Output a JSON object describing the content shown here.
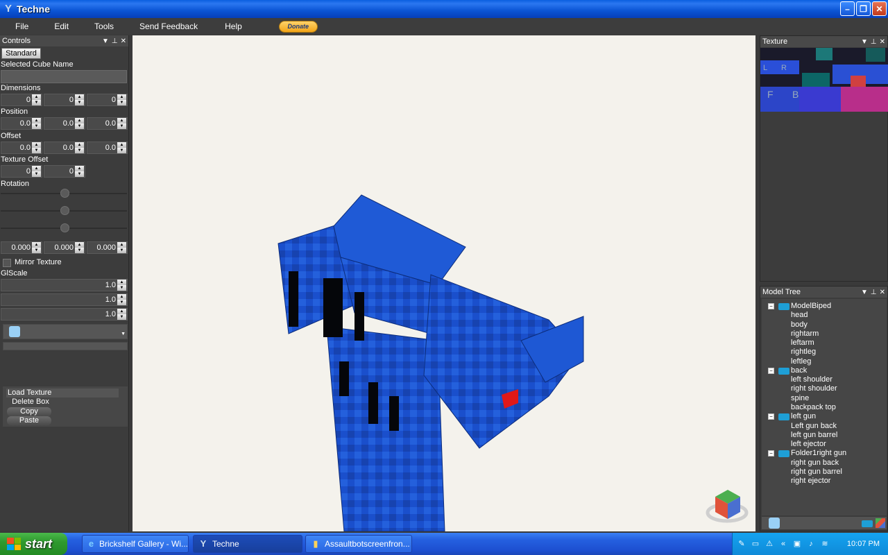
{
  "window": {
    "title": "Techne"
  },
  "menu": {
    "items": [
      "File",
      "Edit",
      "Tools",
      "Send Feedback",
      "Help"
    ],
    "donate": "Donate"
  },
  "controls": {
    "title": "Controls",
    "standard_tab": "Standard",
    "selected_cube_name_label": "Selected Cube Name",
    "selected_cube_name_value": "",
    "dimensions_label": "Dimensions",
    "dimensions": [
      "0",
      "0",
      "0"
    ],
    "position_label": "Position",
    "position": [
      "0.0",
      "0.0",
      "0.0"
    ],
    "offset_label": "Offset",
    "offset": [
      "0.0",
      "0.0",
      "0.0"
    ],
    "texture_offset_label": "Texture Offset",
    "texture_offset": [
      "0",
      "0"
    ],
    "rotation_label": "Rotation",
    "rotation": [
      "0.000",
      "0.000",
      "0.000"
    ],
    "mirror_texture_label": "Mirror Texture",
    "glscale_label": "GlScale",
    "glscale": [
      "1.0",
      "1.0",
      "1.0"
    ],
    "actions": [
      "Load Texture",
      "Delete Box",
      "Copy",
      "Paste"
    ]
  },
  "texture_panel": {
    "title": "Texture",
    "letters": [
      "L",
      "R",
      "F",
      "B"
    ]
  },
  "model_tree": {
    "title": "Model Tree",
    "folders": [
      {
        "name": "ModelBiped",
        "children": [
          "head",
          "body",
          "rightarm",
          "leftarm",
          "rightleg",
          "leftleg"
        ]
      },
      {
        "name": "back",
        "children": [
          "left shoulder",
          "right shoulder",
          "spine",
          "backpack top"
        ]
      },
      {
        "name": "left gun",
        "children": [
          "Left gun back",
          "left gun barrel",
          "left ejector"
        ]
      },
      {
        "name": "Folder1right gun",
        "children": [
          "right gun back",
          "right gun barrel",
          "right ejector"
        ]
      }
    ]
  },
  "taskbar": {
    "start": "start",
    "tasks": [
      "Brickshelf Gallery - Wi...",
      "Techne",
      "Assaultbotscreenfron..."
    ],
    "clock": "10:07 PM"
  },
  "colors": {
    "titlebar": "#0a54d4",
    "panel": "#3c3c3c",
    "viewport": "#f4f2ec",
    "model_blue": "#1a4fcc",
    "taskbar": "#2560e0",
    "start": "#2f9a2f"
  }
}
